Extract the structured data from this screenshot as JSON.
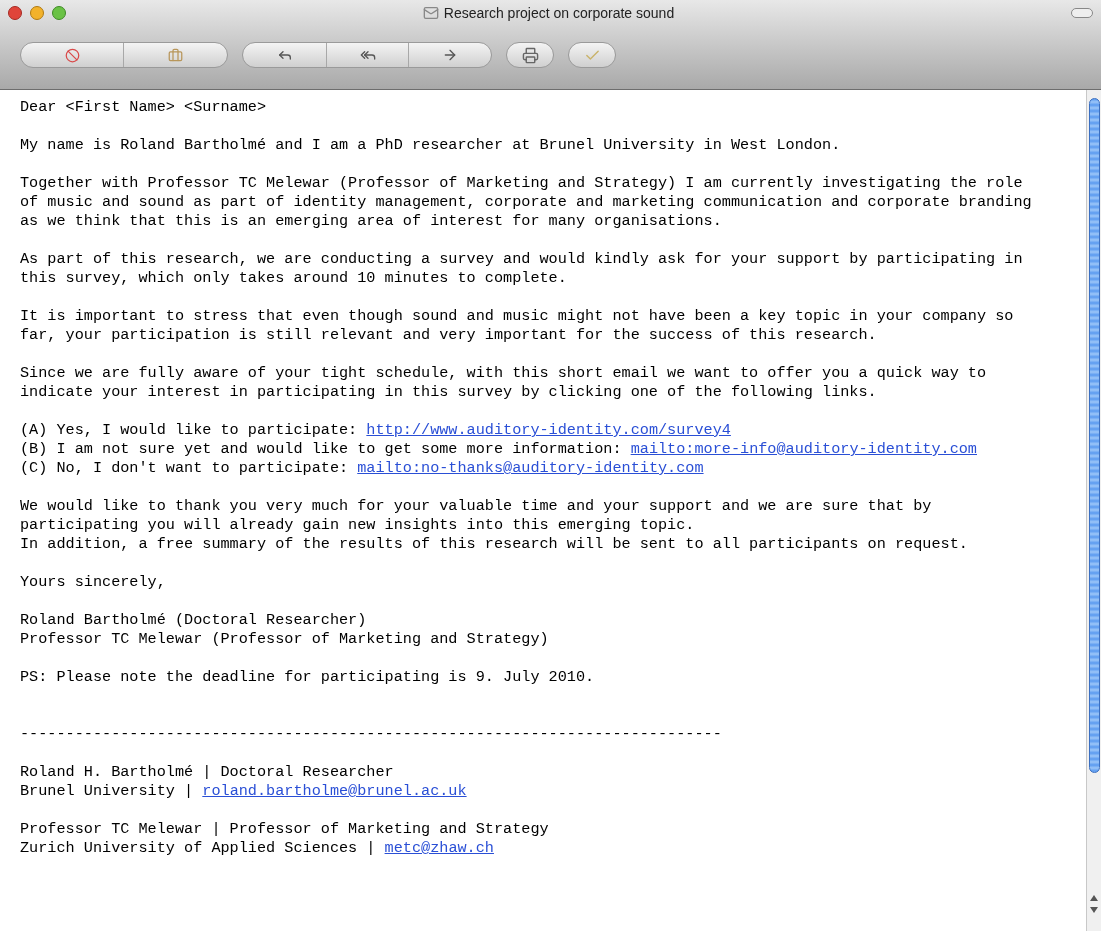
{
  "window": {
    "title": "Research project on corporate sound"
  },
  "message": {
    "greeting": "Dear <First Name> <Surname>",
    "paragraphs": [
      "My name is Roland Bartholmé and I am a PhD researcher at Brunel University in West London.",
      "Together with Professor TC Melewar (Professor of Marketing and Strategy) I am currently investigating the role\nof music and sound as part of identity management, corporate and marketing communication and corporate branding\nas we think that this is an emerging area of interest for many organisations.",
      "As part of this research, we are conducting a survey and would kindly ask for your support by participating in\nthis survey, which only takes around 10 minutes to complete.",
      "It is important to stress that even though sound and music might not have been a key topic in your company so\nfar, your participation is still relevant and very important for the success of this research.",
      "Since we are fully aware of your tight schedule, with this short email we want to offer you a quick way to\nindicate your interest in participating in this survey by clicking one of the following links."
    ],
    "options": [
      {
        "text": "(A) Yes, I would like to participate:",
        "link": "http://www.auditory-identity.com/survey4"
      },
      {
        "text": "(B) I am not sure yet and would like to get some more information:",
        "link": "mailto:more-info@auditory-identity.com"
      },
      {
        "text": "(C) No, I don't want to participate:",
        "link": "mailto:no-thanks@auditory-identity.com"
      }
    ],
    "closing_paragraph": "We would like to thank you very much for your valuable time and your support and we are sure that by\nparticipating you will already gain new insights into this emerging topic.\nIn addition, a free summary of the results of this research will be sent to all participants on request.",
    "sign_off": "Yours sincerely,",
    "signatories": "Roland Bartholmé (Doctoral Researcher)\nProfessor TC Melewar (Professor of Marketing and Strategy)",
    "ps": "PS: Please note the deadline for participating is 9. July 2010.",
    "separator": "-----------------------------------------------------------------------------",
    "signatures": [
      {
        "line1": "Roland H. Bartholmé | Doctoral Researcher",
        "line2": "Brunel University |",
        "link": "roland.bartholme@brunel.ac.uk"
      },
      {
        "line1": "Professor TC Melewar | Professor of Marketing and Strategy",
        "line2": "Zurich University of Applied Sciences |",
        "link": "metc@zhaw.ch"
      }
    ]
  }
}
